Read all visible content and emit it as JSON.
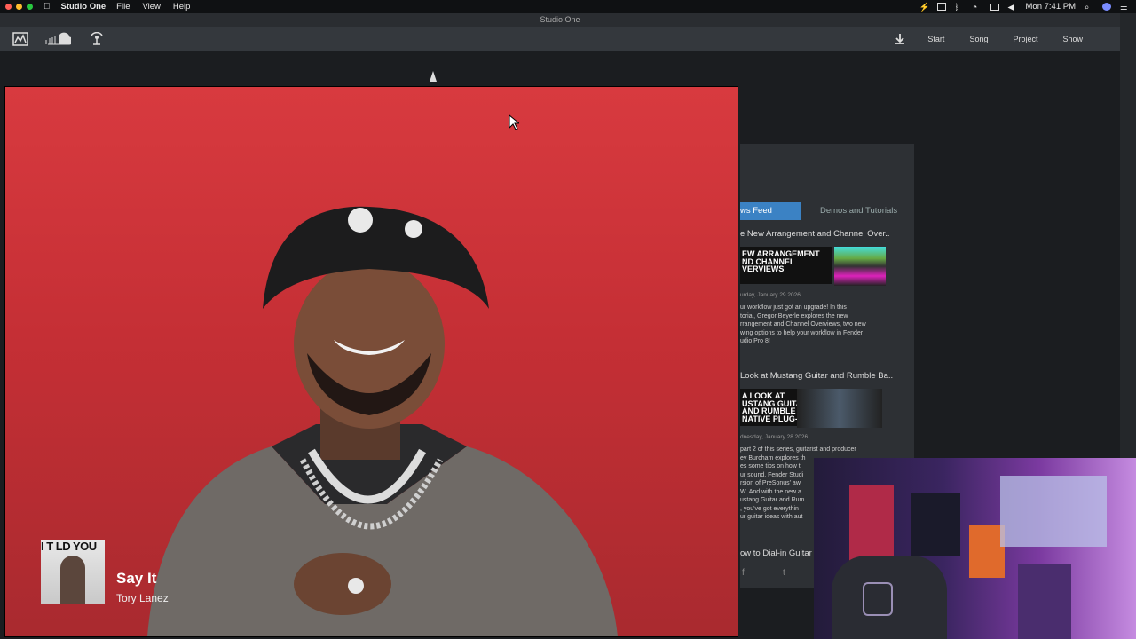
{
  "menubar": {
    "app_name": "Studio One",
    "menus": [
      "File",
      "View",
      "Help"
    ],
    "clock": "Mon 7:41 PM"
  },
  "window": {
    "title": "Studio One"
  },
  "toolbar": {
    "nav": [
      "Start",
      "Song",
      "Project",
      "Show"
    ]
  },
  "news": {
    "tab_active": "ws Feed",
    "tab_other": "Demos and Tutorials",
    "items": [
      {
        "title": "e New Arrangement and Channel Over..",
        "thumb_text": "EW ARRANGEMENT\nND CHANNEL\nVERVIEWS",
        "date": "urday, January 29 2026",
        "body": "ur workflow just got an upgrade! In this\ntorial, Gregor Beyerle explores the new\nrrangement and Channel Overviews, two new\nwing options to help your workflow in Fender\nudio Pro 8!"
      },
      {
        "title": "Look at Mustang Guitar and Rumble Ba..",
        "thumb_text": "A LOOK AT\nUSTANG GUITAR\nAND RUMBLE BASS\nNATIVE PLUG-INS",
        "date": "dnesday, January 28 2026",
        "body": "part 2 of this series, guitarist and producer\ney Burcham explores th\nes some tips on how t\nur sound. Fender Studi\nrsion of PreSonus' aw\nW. And with the new a\nustang Guitar and Rum\n, you've got everythin\nur guitar ideas with aut"
      },
      {
        "title": "ow to Dial-in Guitar"
      }
    ]
  },
  "now_playing": {
    "title": "Say It",
    "artist": "Tory Lanez",
    "album_text": "I T  LD YOU"
  },
  "colors": {
    "accent": "#3b82c4",
    "card_red": "#d83a3f"
  }
}
